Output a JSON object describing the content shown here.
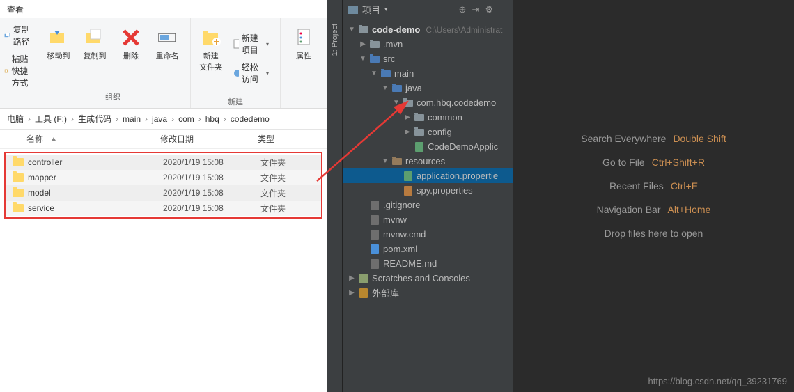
{
  "explorer": {
    "menu_view": "查看",
    "ribbon_left": {
      "copy_path": "复制路径",
      "paste_shortcut": "粘贴快捷方式"
    },
    "ribbon_org": {
      "move_to": "移动到",
      "copy_to": "复制到",
      "delete": "删除",
      "rename": "重命名",
      "group_label": "组织"
    },
    "ribbon_new": {
      "new_folder": "新建\n文件夹",
      "new_item": "新建项目",
      "easy_access": "轻松访问",
      "group_label": "新建"
    },
    "ribbon_props": {
      "properties": "属性"
    },
    "breadcrumb": [
      "电脑",
      "工具 (F:)",
      "生成代码",
      "main",
      "java",
      "com",
      "hbq",
      "codedemo"
    ],
    "columns": {
      "name": "名称",
      "date": "修改日期",
      "type": "类型"
    },
    "rows": [
      {
        "name": "controller",
        "date": "2020/1/19 15:08",
        "type": "文件夹"
      },
      {
        "name": "mapper",
        "date": "2020/1/19 15:08",
        "type": "文件夹"
      },
      {
        "name": "model",
        "date": "2020/1/19 15:08",
        "type": "文件夹"
      },
      {
        "name": "service",
        "date": "2020/1/19 15:08",
        "type": "文件夹"
      }
    ]
  },
  "ide": {
    "sidebar_tab": "1: Project",
    "panel_title": "项目",
    "tree": [
      {
        "indent": 0,
        "arrow": "▼",
        "icon": "dir",
        "label": "code-demo",
        "bold": true,
        "path": "C:\\Users\\Administrat"
      },
      {
        "indent": 1,
        "arrow": "▶",
        "icon": "dir",
        "label": ".mvn"
      },
      {
        "indent": 1,
        "arrow": "▼",
        "icon": "dir-blue",
        "label": "src"
      },
      {
        "indent": 2,
        "arrow": "▼",
        "icon": "dir-blue",
        "label": "main"
      },
      {
        "indent": 3,
        "arrow": "▼",
        "icon": "dir-blue",
        "label": "java"
      },
      {
        "indent": 4,
        "arrow": "▼",
        "icon": "dir",
        "label": "com.hbq.codedemo"
      },
      {
        "indent": 5,
        "arrow": "▶",
        "icon": "dir",
        "label": "common"
      },
      {
        "indent": 5,
        "arrow": "▶",
        "icon": "dir",
        "label": "config"
      },
      {
        "indent": 5,
        "arrow": "",
        "icon": "file-green",
        "label": "CodeDemoApplic"
      },
      {
        "indent": 3,
        "arrow": "▼",
        "icon": "dir-res",
        "label": "resources"
      },
      {
        "indent": 4,
        "arrow": "",
        "icon": "file-green",
        "label": "application.propertie",
        "selected": true
      },
      {
        "indent": 4,
        "arrow": "",
        "icon": "file-yaml",
        "label": "spy.properties"
      },
      {
        "indent": 1,
        "arrow": "",
        "icon": "file",
        "label": ".gitignore"
      },
      {
        "indent": 1,
        "arrow": "",
        "icon": "file",
        "label": "mvnw"
      },
      {
        "indent": 1,
        "arrow": "",
        "icon": "file",
        "label": "mvnw.cmd"
      },
      {
        "indent": 1,
        "arrow": "",
        "icon": "file-xml",
        "label": "pom.xml"
      },
      {
        "indent": 1,
        "arrow": "",
        "icon": "file",
        "label": "README.md"
      },
      {
        "indent": 0,
        "arrow": "▶",
        "icon": "scratch",
        "label": "Scratches and Consoles"
      },
      {
        "indent": 0,
        "arrow": "▶",
        "icon": "lib",
        "label": "外部库"
      }
    ],
    "hints": [
      {
        "label": "Search Everywhere",
        "key": "Double Shift"
      },
      {
        "label": "Go to File",
        "key": "Ctrl+Shift+R"
      },
      {
        "label": "Recent Files",
        "key": "Ctrl+E"
      },
      {
        "label": "Navigation Bar",
        "key": "Alt+Home"
      }
    ],
    "hint_plain": "Drop files here to open",
    "watermark": "https://blog.csdn.net/qq_39231769"
  }
}
